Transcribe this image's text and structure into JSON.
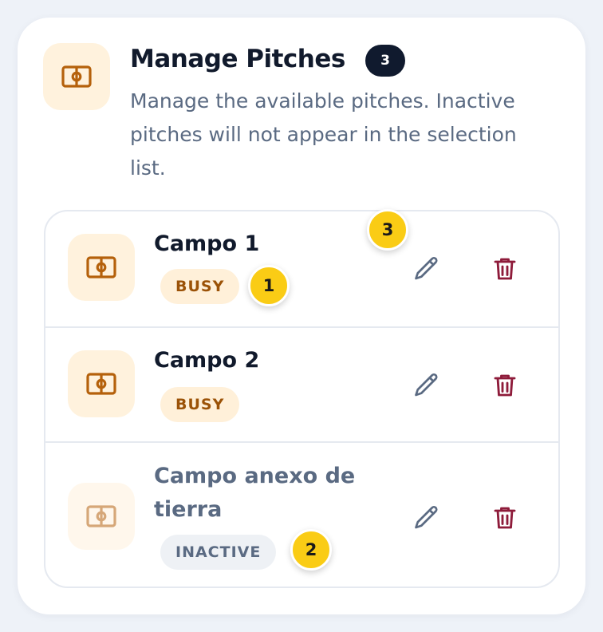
{
  "header": {
    "icon": "pitch-icon",
    "title": "Manage Pitches",
    "count": "3",
    "description": "Manage the available pitches. Inactive pitches will not appear in the selection list."
  },
  "pitches": [
    {
      "name": "Campo 1",
      "status": "BUSY",
      "icon": "pitch-icon",
      "edit_icon": "pencil-icon",
      "delete_icon": "trash-icon"
    },
    {
      "name": "Campo 2",
      "status": "BUSY",
      "icon": "pitch-icon",
      "edit_icon": "pencil-icon",
      "delete_icon": "trash-icon"
    },
    {
      "name": "Campo anexo de tierra",
      "status": "INACTIVE",
      "icon": "pitch-icon",
      "edit_icon": "pencil-icon",
      "delete_icon": "trash-icon"
    }
  ],
  "markers": [
    "1",
    "2",
    "3"
  ],
  "colors": {
    "accent": "#b5610b",
    "busy_bg": "#fff0d9",
    "busy_text": "#9b5207",
    "inactive_bg": "#eef1f5",
    "inactive_text": "#5a6a82",
    "delete": "#8e1b3a",
    "edit": "#5a6a82",
    "marker": "#facc15"
  }
}
